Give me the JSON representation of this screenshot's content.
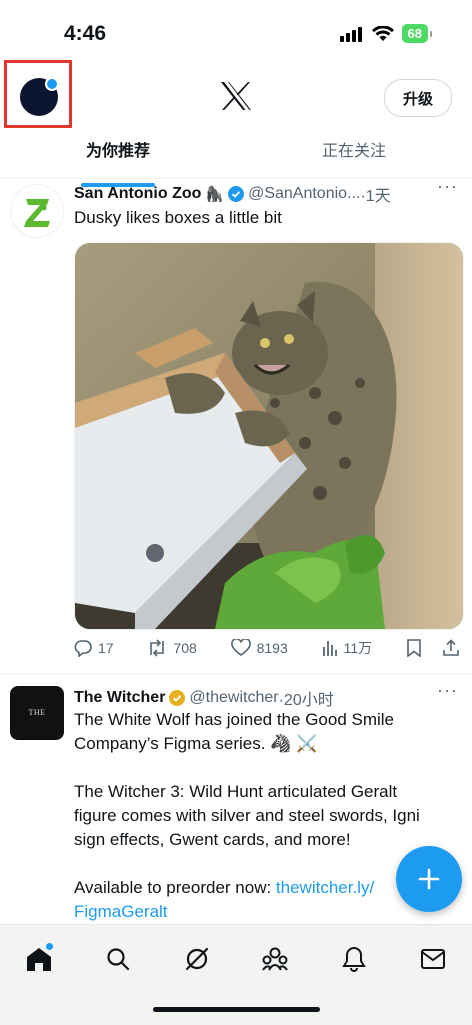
{
  "status": {
    "time": "4:46",
    "battery": "68"
  },
  "header": {
    "upgrade_label": "升级"
  },
  "tabs": [
    {
      "label": "为你推荐",
      "active": true
    },
    {
      "label": "正在关注",
      "active": false
    }
  ],
  "tweets": [
    {
      "name": "San Antonio Zoo",
      "emoji": "🦍",
      "handle": "@SanAntonio...",
      "time": "·1天",
      "text": "Dusky likes boxes a little bit",
      "replies": "17",
      "retweets": "708",
      "likes": "8193",
      "views": "11万"
    },
    {
      "name": "The Witcher",
      "handle": "@thewitcher",
      "time": "·20小时",
      "avatar_text": "THE WITCHER",
      "line1": "The White Wolf has joined the Good Smile",
      "line2": "Company’s Figma series. 🦓 ⚔️",
      "line3": "The Witcher 3: Wild Hunt articulated Geralt",
      "line4": "figure comes with silver and steel swords, Igni",
      "line5": "sign effects, Gwent cards, and more!",
      "line6_prefix": "Available to preorder now: ",
      "line6_link": "thewitcher.ly/",
      "line7_link": "FigmaGeralt"
    }
  ],
  "colors": {
    "accent": "#1d9bf0",
    "highlight_box": "#e0392b",
    "gold": "#e8b020"
  },
  "icons": [
    "home-icon",
    "search-icon",
    "grok-icon",
    "communities-icon",
    "notifications-icon",
    "messages-icon"
  ]
}
